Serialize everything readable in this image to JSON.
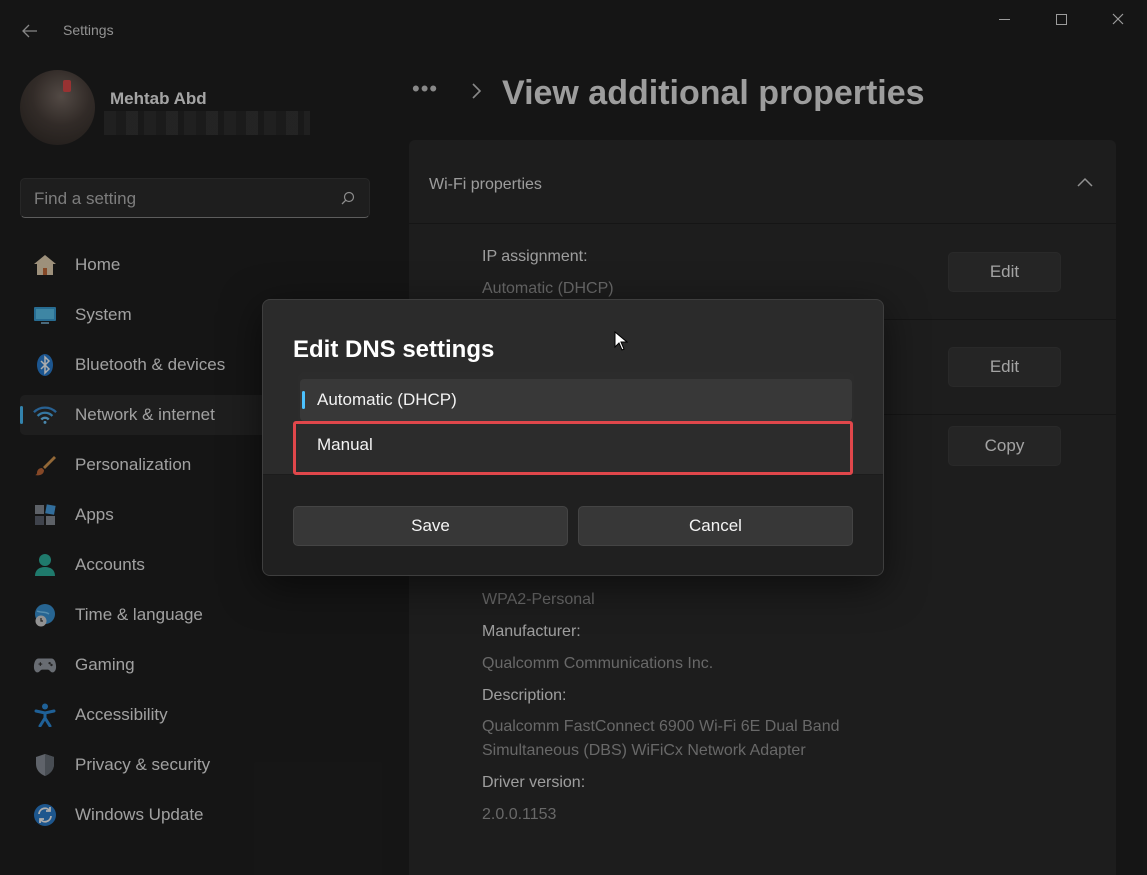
{
  "window": {
    "app_title": "Settings",
    "back_icon": "arrow-left-icon",
    "minimize_icon": "minimize-icon",
    "maximize_icon": "maximize-icon",
    "close_icon": "close-icon"
  },
  "profile": {
    "name": "Mehtab Abd"
  },
  "search": {
    "placeholder": "Find a setting",
    "icon": "search-icon"
  },
  "sidebar": {
    "items": [
      {
        "label": "Home",
        "icon": "home-icon"
      },
      {
        "label": "System",
        "icon": "system-icon"
      },
      {
        "label": "Bluetooth & devices",
        "icon": "bluetooth-icon"
      },
      {
        "label": "Network & internet",
        "icon": "wifi-icon",
        "active": true
      },
      {
        "label": "Personalization",
        "icon": "brush-icon"
      },
      {
        "label": "Apps",
        "icon": "apps-icon"
      },
      {
        "label": "Accounts",
        "icon": "person-icon"
      },
      {
        "label": "Time & language",
        "icon": "globe-clock-icon"
      },
      {
        "label": "Gaming",
        "icon": "gamepad-icon"
      },
      {
        "label": "Accessibility",
        "icon": "accessibility-icon"
      },
      {
        "label": "Privacy & security",
        "icon": "shield-icon"
      },
      {
        "label": "Windows Update",
        "icon": "update-icon"
      }
    ]
  },
  "header": {
    "breadcrumb_more": "•••",
    "title": "View additional properties"
  },
  "card": {
    "title": "Wi-Fi properties",
    "ip_assignment_label": "IP assignment:",
    "ip_assignment_value": "Automatic (DHCP)",
    "edit_label_1": "Edit",
    "edit_label_2": "Edit",
    "copy_label": "Copy",
    "security_value": "WPA2-Personal",
    "manufacturer_label": "Manufacturer:",
    "manufacturer_value": "Qualcomm Communications Inc.",
    "description_label": "Description:",
    "description_line1": "Qualcomm FastConnect 6900 Wi-Fi 6E Dual Band",
    "description_line2": "Simultaneous (DBS) WiFiCx Network Adapter",
    "driver_label": "Driver version:",
    "driver_value": "2.0.0.1153"
  },
  "dialog": {
    "title": "Edit DNS settings",
    "options": [
      "Automatic (DHCP)",
      "Manual"
    ],
    "selected": "Automatic (DHCP)",
    "save_label": "Save",
    "cancel_label": "Cancel"
  },
  "colors": {
    "accent": "#4cc2ff",
    "highlight_border": "#e0474b"
  }
}
